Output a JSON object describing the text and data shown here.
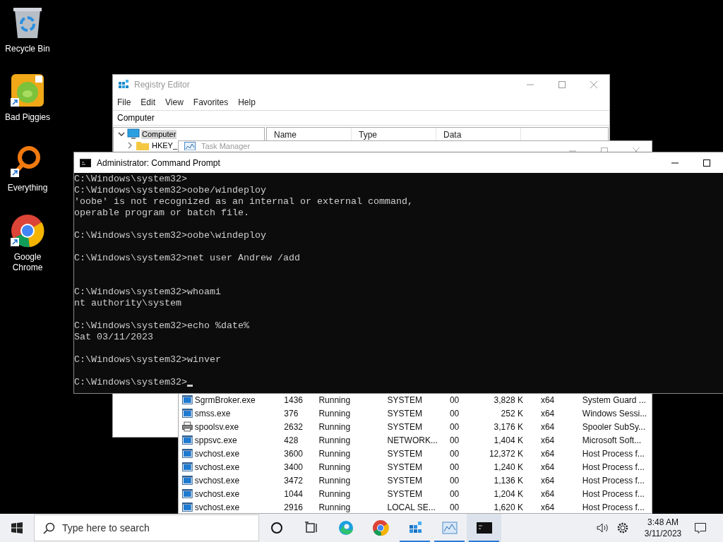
{
  "desktop_icons": [
    {
      "label": "Recycle Bin",
      "kind": "recycle",
      "shortcut": false
    },
    {
      "label": "Bad Piggies",
      "kind": "game",
      "shortcut": true
    },
    {
      "label": "Everything",
      "kind": "search",
      "shortcut": true
    },
    {
      "label": "Google Chrome",
      "kind": "browser",
      "shortcut": true
    }
  ],
  "registry_editor": {
    "title": "Registry Editor",
    "menu": [
      "File",
      "Edit",
      "View",
      "Favorites",
      "Help"
    ],
    "address": "Computer",
    "tree": [
      {
        "label": "Computer",
        "expanded": true,
        "selected": true,
        "children": [
          {
            "label": "HKEY_",
            "expanded": false,
            "selected": false
          }
        ]
      }
    ],
    "columns": [
      "Name",
      "Type",
      "Data"
    ]
  },
  "task_manager": {
    "title": "Task Manager",
    "rows": [
      {
        "kind": "app",
        "name": "SgrmBroker.exe",
        "pid": "1436",
        "status": "Running",
        "user": "SYSTEM",
        "cpu": "00",
        "memory": "3,828 K",
        "arch": "x64",
        "description": "System Guard ..."
      },
      {
        "kind": "app",
        "name": "smss.exe",
        "pid": "376",
        "status": "Running",
        "user": "SYSTEM",
        "cpu": "00",
        "memory": "252 K",
        "arch": "x64",
        "description": "Windows Sessi..."
      },
      {
        "kind": "printer",
        "name": "spoolsv.exe",
        "pid": "2632",
        "status": "Running",
        "user": "SYSTEM",
        "cpu": "00",
        "memory": "3,176 K",
        "arch": "x64",
        "description": "Spooler SubSy..."
      },
      {
        "kind": "app",
        "name": "sppsvc.exe",
        "pid": "428",
        "status": "Running",
        "user": "NETWORK...",
        "cpu": "00",
        "memory": "1,404 K",
        "arch": "x64",
        "description": "Microsoft Soft..."
      },
      {
        "kind": "app",
        "name": "svchost.exe",
        "pid": "3600",
        "status": "Running",
        "user": "SYSTEM",
        "cpu": "00",
        "memory": "12,372 K",
        "arch": "x64",
        "description": "Host Process f..."
      },
      {
        "kind": "app",
        "name": "svchost.exe",
        "pid": "3400",
        "status": "Running",
        "user": "SYSTEM",
        "cpu": "00",
        "memory": "1,240 K",
        "arch": "x64",
        "description": "Host Process f..."
      },
      {
        "kind": "app",
        "name": "svchost.exe",
        "pid": "3472",
        "status": "Running",
        "user": "SYSTEM",
        "cpu": "00",
        "memory": "1,136 K",
        "arch": "x64",
        "description": "Host Process f..."
      },
      {
        "kind": "app",
        "name": "svchost.exe",
        "pid": "1044",
        "status": "Running",
        "user": "SYSTEM",
        "cpu": "00",
        "memory": "1,204 K",
        "arch": "x64",
        "description": "Host Process f..."
      },
      {
        "kind": "app",
        "name": "svchost.exe",
        "pid": "2916",
        "status": "Running",
        "user": "LOCAL SE...",
        "cpu": "00",
        "memory": "1,620 K",
        "arch": "x64",
        "description": "Host Process f..."
      }
    ]
  },
  "command_prompt": {
    "title": "Administrator:  Command Prompt",
    "lines": [
      {
        "kind": "text",
        "text": "C:\\Windows\\system32>"
      },
      {
        "kind": "text",
        "text": "C:\\Windows\\system32>oobe/windeploy"
      },
      {
        "kind": "text",
        "text": "'oobe' is not recognized as an internal or external command,"
      },
      {
        "kind": "text",
        "text": "operable program or batch file."
      },
      {
        "kind": "blank"
      },
      {
        "kind": "text",
        "text": "C:\\Windows\\system32>oobe\\windeploy"
      },
      {
        "kind": "blank"
      },
      {
        "kind": "text",
        "text": "C:\\Windows\\system32>net user Andrew /add"
      },
      {
        "kind": "blank"
      },
      {
        "kind": "blank"
      },
      {
        "kind": "text",
        "text": "C:\\Windows\\system32>whoami"
      },
      {
        "kind": "text",
        "text": "nt authority\\system"
      },
      {
        "kind": "blank"
      },
      {
        "kind": "text",
        "text": "C:\\Windows\\system32>echo %date%"
      },
      {
        "kind": "text",
        "text": "Sat 03/11/2023"
      },
      {
        "kind": "blank"
      },
      {
        "kind": "text",
        "text": "C:\\Windows\\system32>winver"
      },
      {
        "kind": "blank"
      },
      {
        "kind": "prompt",
        "text": "C:\\Windows\\system32>"
      }
    ]
  },
  "taskbar": {
    "search_placeholder": "Type here to search",
    "apps": [
      {
        "kind": "cortana",
        "running": false,
        "active": false
      },
      {
        "kind": "taskview",
        "running": false,
        "active": false
      },
      {
        "kind": "edge",
        "running": false,
        "active": false
      },
      {
        "kind": "chrome",
        "running": false,
        "active": false
      },
      {
        "kind": "regedit",
        "running": true,
        "active": false
      },
      {
        "kind": "taskmgr",
        "running": true,
        "active": false
      },
      {
        "kind": "cmd",
        "running": true,
        "active": true
      }
    ],
    "time": "3:48 AM",
    "date": "3/11/2023"
  }
}
